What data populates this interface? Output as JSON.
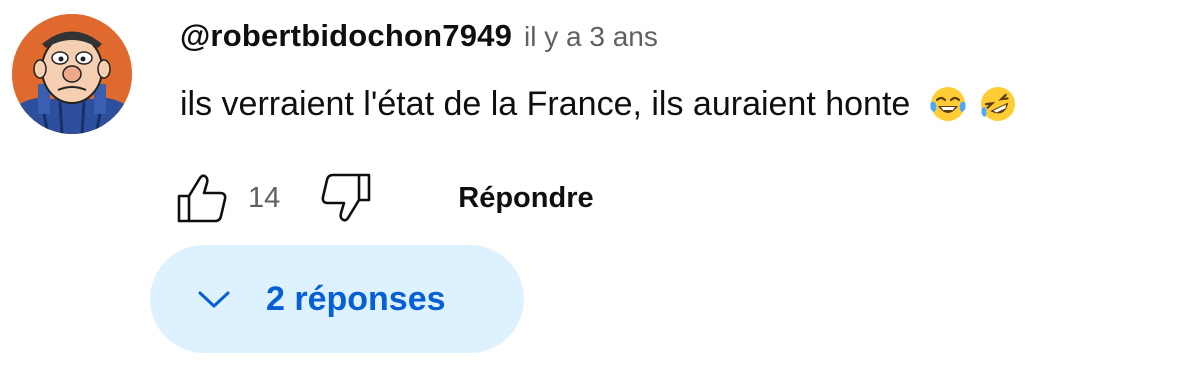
{
  "comment": {
    "author": "@robertbidochon7949",
    "timestamp": "il y a 3 ans",
    "text": "ils verraient l'état de la France, ils auraient honte",
    "emojis": [
      "😂",
      "🤣"
    ],
    "avatar_icon": "cartoon-character-avatar",
    "likes": "14",
    "like_icon": "thumb-up-icon",
    "dislike_icon": "thumb-down-icon",
    "reply_label": "Répondre",
    "replies_label": "2 réponses",
    "replies_icon": "chevron-down-icon"
  },
  "colors": {
    "text": "#0f0f0f",
    "muted": "#606060",
    "accent": "#065fd4",
    "replies_bg": "#def1ff",
    "avatar_bg": "#e06a2e"
  }
}
